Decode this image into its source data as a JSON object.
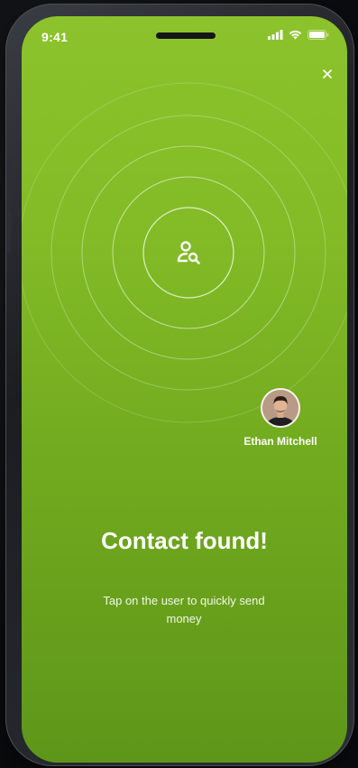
{
  "status_bar": {
    "time": "9:41",
    "icons": [
      "signal-icon",
      "wifi-icon",
      "battery-icon"
    ]
  },
  "header": {
    "close_icon": "close-icon"
  },
  "radar": {
    "center_icon": "user-search-icon"
  },
  "contact": {
    "name": "Ethan Mitchell"
  },
  "main": {
    "title": "Contact found!",
    "subtitle": "Tap on the user to quickly send money"
  },
  "colors": {
    "background_top": "#8cc32c",
    "background_bottom": "#5e961a",
    "text": "#ffffff"
  }
}
